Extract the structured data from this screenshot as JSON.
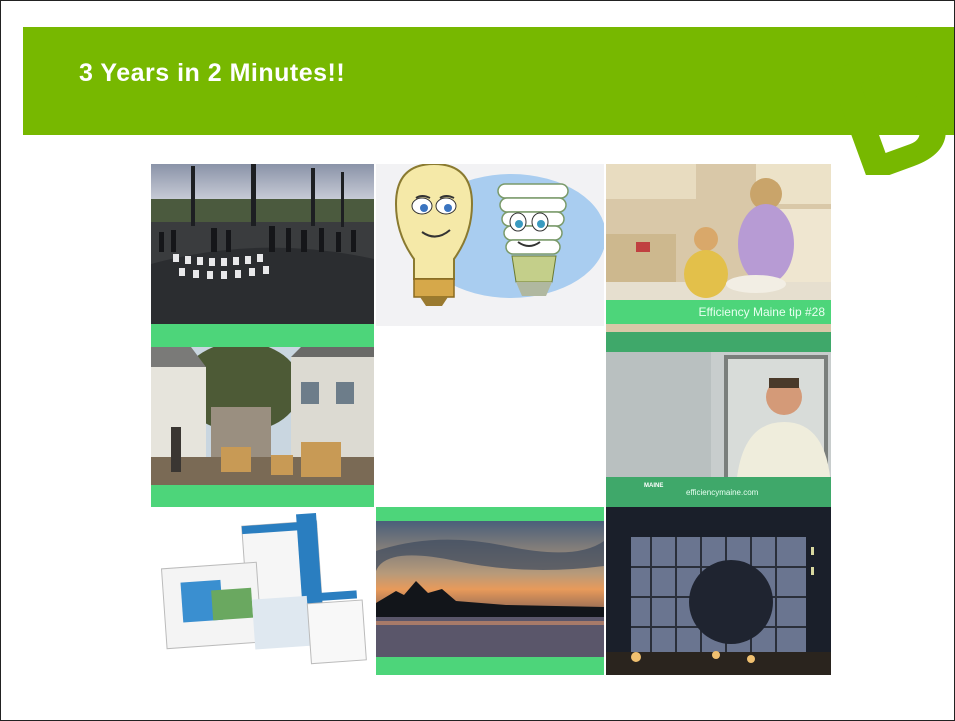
{
  "slide": {
    "title": "3 Years in 2 Minutes!!"
  },
  "logo": {
    "letter": "B",
    "color": "#77b800"
  },
  "colors": {
    "banner": "#77b800",
    "stripe": "#4dd57a"
  },
  "photos": [
    {
      "name": "outdoor-ceremony-photo"
    },
    {
      "name": "lightbulb-cartoon"
    },
    {
      "name": "kitchen-video-still",
      "caption": "Efficiency Maine tip #28"
    },
    {
      "name": "houses-photo"
    },
    {
      "name": "blank-cell"
    },
    {
      "name": "spokesman-video-still",
      "brand": "MAINE",
      "caption": "efficiencymaine.com"
    },
    {
      "name": "brochures-photo"
    },
    {
      "name": "lake-sunset-photo"
    },
    {
      "name": "night-building-photo"
    }
  ]
}
